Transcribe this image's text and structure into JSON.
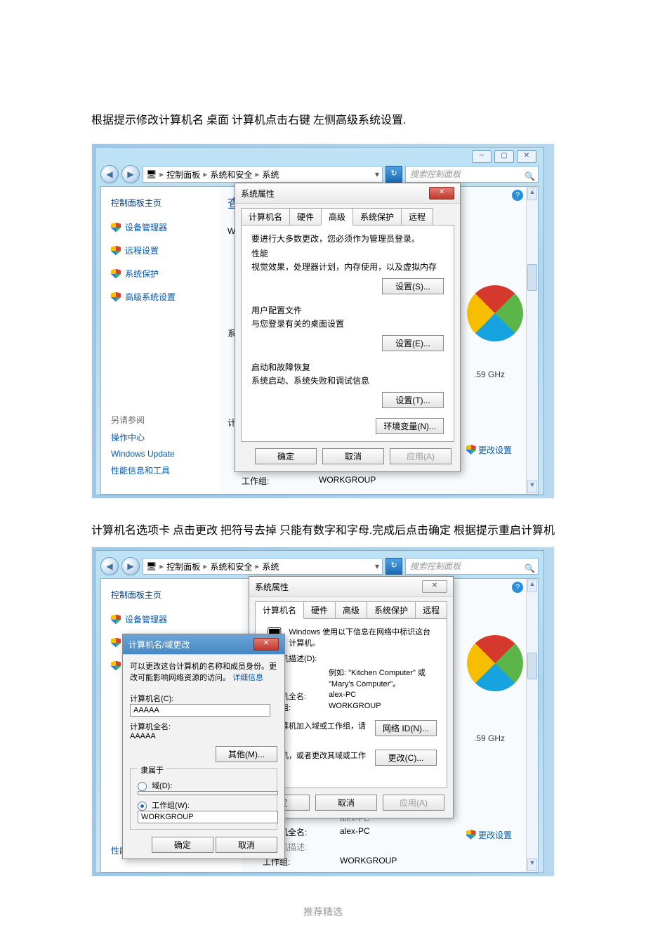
{
  "instr1": "根据提示修改计算机名 桌面 计算机点击右键   左侧高级系统设置.",
  "instr2": "计算机名选项卡 点击更改 把符号去掉 只能有数字和字母.完成后点击确定 根据提示重启计算机",
  "footer": "推荐精选",
  "common": {
    "breadcrumb": [
      "控制面板",
      "系统和安全",
      "系统"
    ],
    "search_placeholder": "搜索控制面板",
    "sidebar": {
      "title": "控制面板主页",
      "items": [
        "设备管理器",
        "远程设置",
        "系统保护",
        "高级系统设置"
      ],
      "see_also_hd": "另请参阅",
      "see_also": [
        "操作中心",
        "Windows Update",
        "性能信息和工具"
      ]
    },
    "partial_view": "查",
    "partial_win": "Win",
    "partial_sys": "系统",
    "partial_ji": "计算",
    "ghz": ".59 GHz",
    "change_settings": "更改设置",
    "details": {
      "full_name_k": "计算机全名:",
      "full_name_v": "alex-PC",
      "desc_k": "计算机描述:",
      "workgroup_k": "工作组:",
      "workgroup_v": "WORKGROUP",
      "alex_row": "alex-PC"
    }
  },
  "dlg1": {
    "title": "系统属性",
    "tabs": [
      "计算机名",
      "硬件",
      "高级",
      "系统保护",
      "远程"
    ],
    "active_tab": 2,
    "admin_note": "要进行大多数更改，您必须作为管理员登录。",
    "perf_hd": "性能",
    "perf_sub": "视觉效果，处理器计划，内存使用，以及虚拟内存",
    "btn_settings_s": "设置(S)...",
    "profile_hd": "用户配置文件",
    "profile_sub": "与您登录有关的桌面设置",
    "btn_settings_e": "设置(E)...",
    "startup_hd": "启动和故障恢复",
    "startup_sub": "系统启动、系统失败和调试信息",
    "btn_settings_t": "设置(T)...",
    "btn_env": "环境变量(N)...",
    "btn_ok": "确定",
    "btn_cancel": "取消",
    "btn_apply": "应用(A)"
  },
  "dlg2": {
    "title": "系统属性",
    "tabs": [
      "计算机名",
      "硬件",
      "高级",
      "系统保护",
      "远程"
    ],
    "active_tab": 0,
    "intro": "Windows 使用以下信息在网络中标识这台计算机。",
    "desc_label": "计算机描述(D):",
    "example": "例如: \"Kitchen Computer\" 或 \"Mary's Computer\"。",
    "full_name_k": "计算机全名:",
    "full_name_v": "alex-PC",
    "workgroup_k": "工作组:",
    "workgroup_v": "WORKGROUP",
    "netid_text": "将计算机加入域或工作组，请单",
    "btn_netid": "网络 ID(N)...",
    "change_text": "计算机，或者更改其域或工作组，",
    "btn_change": "更改(C)...",
    "btn_ok": "确定",
    "btn_cancel": "取消",
    "btn_apply": "应用(A)"
  },
  "rename": {
    "title": "计算机名/域更改",
    "desc": "可以更改这台计算机的名称和成员身份。更改可能影响网络资源的访问。",
    "more": "详细信息",
    "name_label": "计算机名(C):",
    "name_value": "AAAAA",
    "full_label": "计算机全名:",
    "full_value": "AAAAA",
    "btn_other": "其他(M)...",
    "member_hd": "隶属于",
    "domain_label": "域(D):",
    "workgroup_label": "工作组(W):",
    "workgroup_value": "WORKGROUP",
    "btn_ok": "确定",
    "btn_cancel": "取消"
  },
  "sidebar2_items": [
    "设备管理器",
    "远程设置",
    "系统保护"
  ]
}
